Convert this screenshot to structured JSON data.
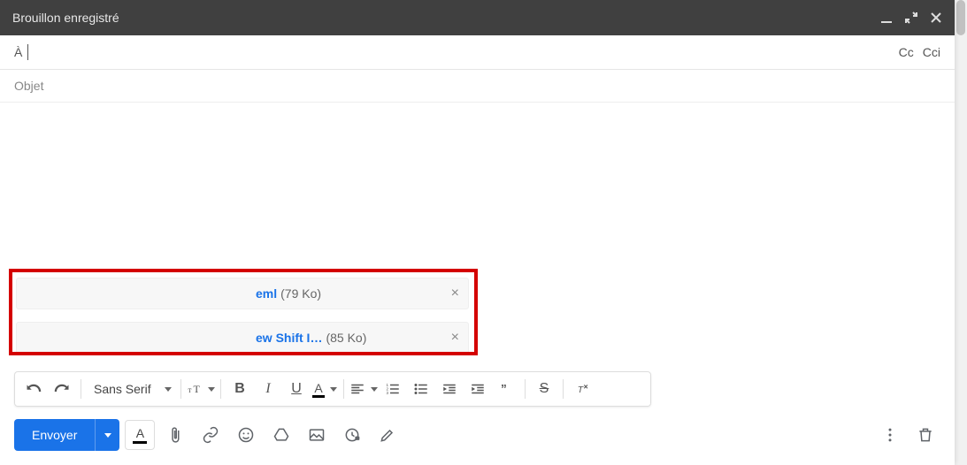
{
  "header": {
    "title": "Brouillon enregistré"
  },
  "to": {
    "label": "À",
    "cc": "Cc",
    "cci": "Cci"
  },
  "subject": {
    "placeholder": "Objet"
  },
  "attachments": [
    {
      "name": "eml",
      "size": "(79 Ko)"
    },
    {
      "name": "ew Shift I…",
      "size": "(85 Ko)"
    }
  ],
  "format": {
    "font": "Sans Serif"
  },
  "send": {
    "label": "Envoyer"
  }
}
